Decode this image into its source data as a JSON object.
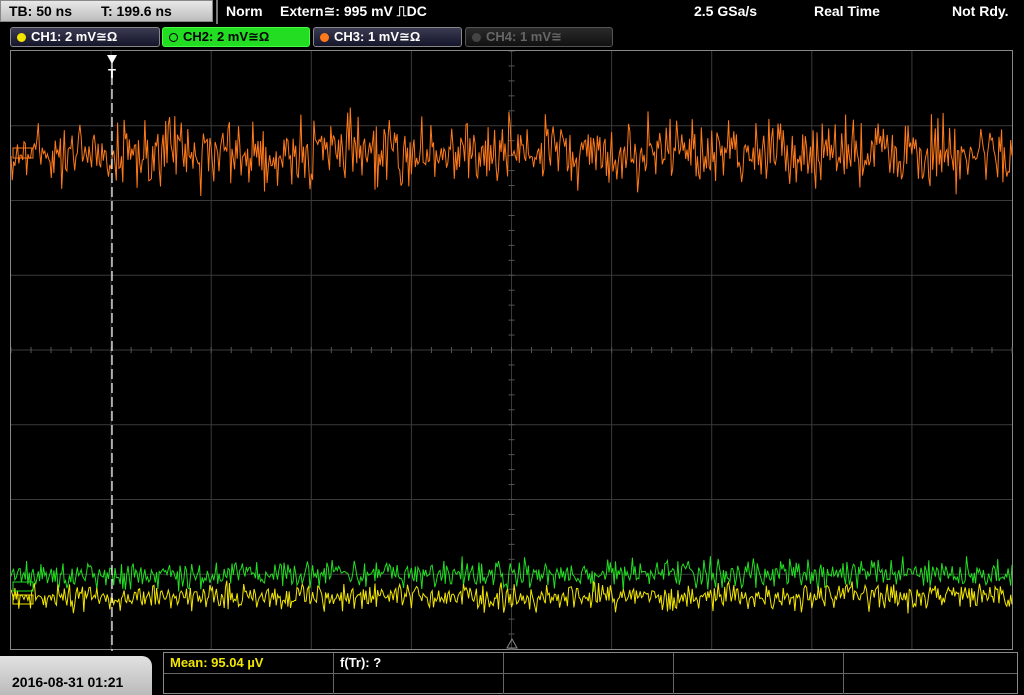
{
  "topbar": {
    "timebase": "TB: 50 ns",
    "trigger_time": "T: 199.6 ns",
    "mode": "Norm",
    "trigger_source": "Extern≅: 995 mV ⎍DC",
    "sample_rate": "2.5 GSa/s",
    "acq_mode": "Real Time",
    "status": "Not Rdy."
  },
  "channels": [
    {
      "label": "CH1: 2 mV≅Ω",
      "color": "#f2e600",
      "state": "on"
    },
    {
      "label": "CH2: 2 mV≅Ω",
      "color": "#22dd22",
      "state": "active"
    },
    {
      "label": "CH3: 1 mV≅Ω",
      "color": "#ff7a1a",
      "state": "on"
    },
    {
      "label": "CH4: 1 mV≅",
      "color": "#555555",
      "state": "off"
    }
  ],
  "trigger_marker": "T",
  "footer": {
    "datetime": "2016-08-31 01:21",
    "mean_label": "Mean: 95.04 µV",
    "ftr_label": "f(Tr): ?"
  },
  "colors": {
    "ch1": "#f2e600",
    "ch2": "#22dd22",
    "ch3": "#ff7a1a",
    "grid": "#3a3a3a",
    "mean_text": "#f2e600"
  }
}
